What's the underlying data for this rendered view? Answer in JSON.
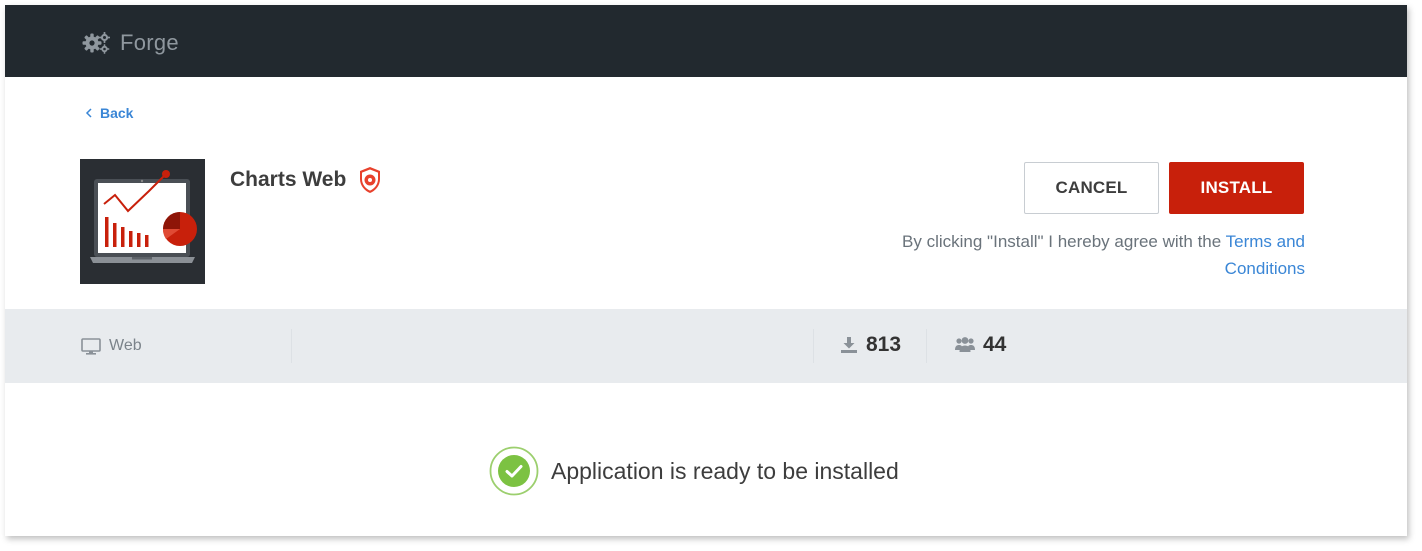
{
  "header": {
    "brand_name": "Forge",
    "brand_icon": "gears-icon",
    "background": "#22292f"
  },
  "nav": {
    "back_label": "Back",
    "back_icon": "chevron-left-icon"
  },
  "app": {
    "name": "Charts Web",
    "badge_icon": "shield-icon",
    "thumbnail_icon": "laptop-chart-icon"
  },
  "actions": {
    "cancel_label": "CANCEL",
    "install_label": "INSTALL",
    "terms_prefix": "By clicking \"Install\" I hereby agree with the ",
    "terms_link": "Terms and Conditions",
    "accent": "#c8200b",
    "link_color": "#3a86d6"
  },
  "stats": {
    "platform_label": "Web",
    "platform_icon": "monitor-icon",
    "downloads": "813",
    "downloads_icon": "download-icon",
    "users": "44",
    "users_icon": "users-icon"
  },
  "status": {
    "message": "Application is ready to be installed",
    "icon": "check-circle-icon",
    "color": "#7cc242"
  }
}
